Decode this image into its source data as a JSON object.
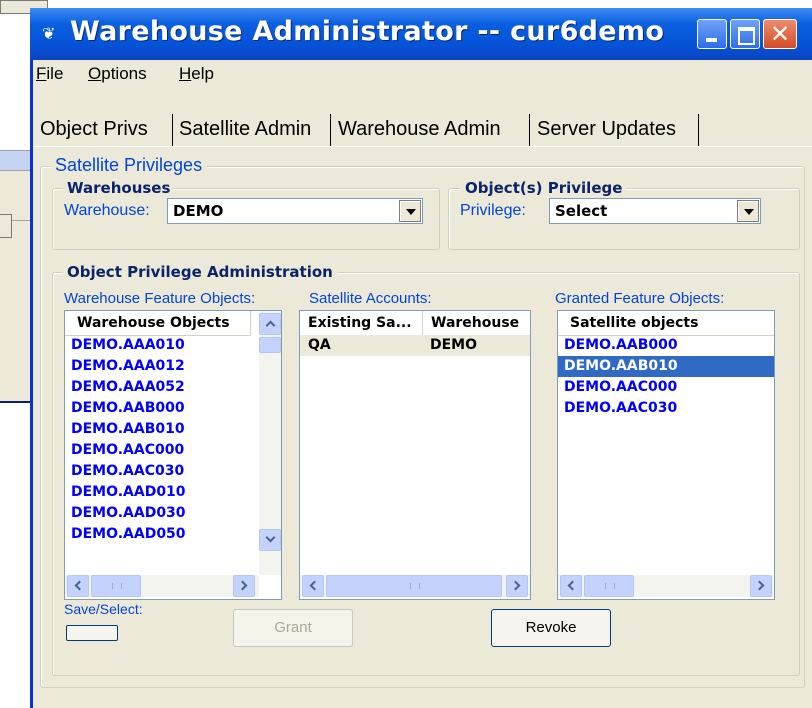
{
  "window": {
    "title": "Warehouse Administrator -- cur6demo",
    "app_icon": "warehouse-app-icon"
  },
  "menu": [
    {
      "label": "File",
      "mnemonic": "F",
      "rest": "ile"
    },
    {
      "label": "Options",
      "mnemonic": "O",
      "rest": "ptions"
    },
    {
      "label": "Help",
      "mnemonic": "H",
      "rest": "elp"
    }
  ],
  "tabs": [
    {
      "label": "Object Privs",
      "active": true
    },
    {
      "label": "Satellite Admin",
      "active": false
    },
    {
      "label": "Warehouse Admin",
      "active": false
    },
    {
      "label": "Server Updates",
      "active": false
    }
  ],
  "satellite_privileges": {
    "legend": "Satellite Privileges",
    "warehouses": {
      "legend": "Warehouses",
      "label": "Warehouse:",
      "value": "DEMO"
    },
    "object_privilege": {
      "legend": "Object(s) Privilege",
      "label": "Privilege:",
      "value": "Select"
    },
    "admin": {
      "legend": "Object Privilege Administration",
      "feature_objects_label": "Warehouse Feature Objects:",
      "satellite_accounts_label": "Satellite Accounts:",
      "granted_objects_label": "Granted Feature Objects:",
      "warehouse_objects": {
        "header": "Warehouse Objects",
        "items": [
          "DEMO.AAA010",
          "DEMO.AAA012",
          "DEMO.AAA052",
          "DEMO.AAB000",
          "DEMO.AAB010",
          "DEMO.AAC000",
          "DEMO.AAC030",
          "DEMO.AAD010",
          "DEMO.AAD030",
          "DEMO.AAD050"
        ]
      },
      "satellite_accounts": {
        "headers": [
          "Existing Sa...",
          "Warehouse"
        ],
        "rows": [
          [
            "QA",
            "DEMO"
          ]
        ]
      },
      "granted_objects": {
        "header": "Satellite objects",
        "items": [
          "DEMO.AAB000",
          "DEMO.AAB010",
          "DEMO.AAC000",
          "DEMO.AAC030"
        ],
        "selected_index": 1
      }
    },
    "save_select_label": "Save/Select:",
    "grant_label": "Grant",
    "revoke_label": "Revoke"
  },
  "colors": {
    "title_bar": "#0553d8",
    "label_blue": "#0046d5",
    "item_blue": "#0000ff",
    "selection": "#316ac5",
    "face": "#ece9d8"
  }
}
